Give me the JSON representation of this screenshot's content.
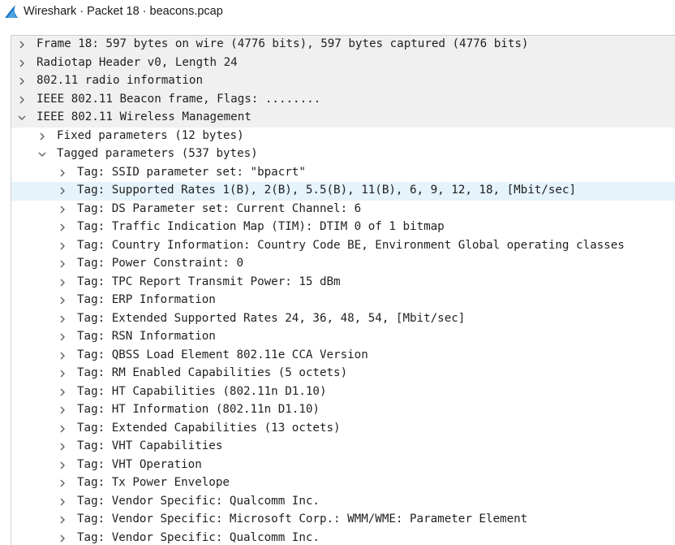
{
  "window": {
    "title": "Wireshark · Packet 18 · beacons.pcap"
  },
  "tree": [
    {
      "label": "Frame 18: 597 bytes on wire (4776 bits), 597 bytes captured (4776 bits)",
      "level": 0,
      "expanded": false
    },
    {
      "label": "Radiotap Header v0, Length 24",
      "level": 0,
      "expanded": false
    },
    {
      "label": "802.11 radio information",
      "level": 0,
      "expanded": false
    },
    {
      "label": "IEEE 802.11 Beacon frame, Flags: ........",
      "level": 0,
      "expanded": false
    },
    {
      "label": "IEEE 802.11 Wireless Management",
      "level": 0,
      "expanded": true
    },
    {
      "label": "Fixed parameters (12 bytes)",
      "level": 1,
      "expanded": false
    },
    {
      "label": "Tagged parameters (537 bytes)",
      "level": 1,
      "expanded": true
    },
    {
      "label": "Tag: SSID parameter set: \"bpacrt\"",
      "level": 2,
      "expanded": false
    },
    {
      "label": "Tag: Supported Rates 1(B), 2(B), 5.5(B), 11(B), 6, 9, 12, 18, [Mbit/sec]",
      "level": 2,
      "expanded": false,
      "selected": true
    },
    {
      "label": "Tag: DS Parameter set: Current Channel: 6",
      "level": 2,
      "expanded": false
    },
    {
      "label": "Tag: Traffic Indication Map (TIM): DTIM 0 of 1 bitmap",
      "level": 2,
      "expanded": false
    },
    {
      "label": "Tag: Country Information: Country Code BE, Environment Global operating classes",
      "level": 2,
      "expanded": false
    },
    {
      "label": "Tag: Power Constraint: 0",
      "level": 2,
      "expanded": false
    },
    {
      "label": "Tag: TPC Report Transmit Power: 15 dBm",
      "level": 2,
      "expanded": false
    },
    {
      "label": "Tag: ERP Information",
      "level": 2,
      "expanded": false
    },
    {
      "label": "Tag: Extended Supported Rates 24, 36, 48, 54, [Mbit/sec]",
      "level": 2,
      "expanded": false
    },
    {
      "label": "Tag: RSN Information",
      "level": 2,
      "expanded": false
    },
    {
      "label": "Tag: QBSS Load Element 802.11e CCA Version",
      "level": 2,
      "expanded": false
    },
    {
      "label": "Tag: RM Enabled Capabilities (5 octets)",
      "level": 2,
      "expanded": false
    },
    {
      "label": "Tag: HT Capabilities (802.11n D1.10)",
      "level": 2,
      "expanded": false
    },
    {
      "label": "Tag: HT Information (802.11n D1.10)",
      "level": 2,
      "expanded": false
    },
    {
      "label": "Tag: Extended Capabilities (13 octets)",
      "level": 2,
      "expanded": false
    },
    {
      "label": "Tag: VHT Capabilities",
      "level": 2,
      "expanded": false
    },
    {
      "label": "Tag: VHT Operation",
      "level": 2,
      "expanded": false
    },
    {
      "label": "Tag: Tx Power Envelope",
      "level": 2,
      "expanded": false
    },
    {
      "label": "Tag: Vendor Specific: Qualcomm Inc.",
      "level": 2,
      "expanded": false
    },
    {
      "label": "Tag: Vendor Specific: Microsoft Corp.: WMM/WME: Parameter Element",
      "level": 2,
      "expanded": false
    },
    {
      "label": "Tag: Vendor Specific: Qualcomm Inc.",
      "level": 2,
      "expanded": false
    }
  ],
  "colors": {
    "selected_row": "#e5f3fb",
    "shaded_row": "#f0f0f0",
    "arrow": "#5a5a5a",
    "icon_blue": "#1679c9"
  },
  "icons": {
    "app": "wireshark-fin-icon",
    "collapsed": "chevron-right-icon",
    "expanded": "chevron-down-icon"
  }
}
